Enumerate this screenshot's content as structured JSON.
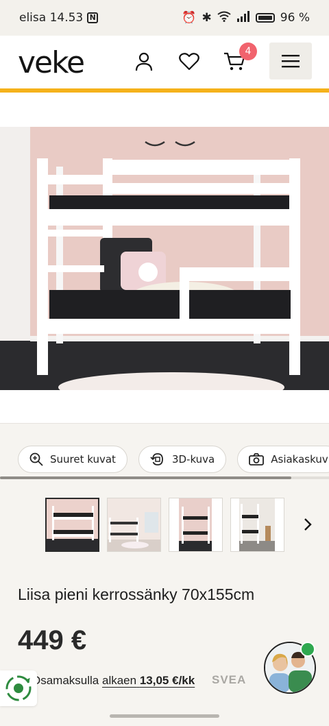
{
  "status_bar": {
    "carrier_time": "elisa 14.53",
    "nfc": "N",
    "battery": "96 %"
  },
  "header": {
    "logo": "veke",
    "cart_count": "4",
    "icons": [
      "user-icon",
      "heart-icon",
      "cart-icon",
      "menu-icon"
    ]
  },
  "colors": {
    "accent": "#f5b21b",
    "badge": "#f1636d",
    "online": "#2fa84f"
  },
  "actions": [
    {
      "label": "Suuret kuvat",
      "icon": "zoom-in-icon"
    },
    {
      "label": "3D-kuva",
      "icon": "rotate-3d-icon"
    },
    {
      "label": "Asiakaskuv",
      "icon": "camera-icon"
    }
  ],
  "product": {
    "title": "Liisa pieni kerrossänky 70x155cm",
    "price": "449 €",
    "installment_prefix": "Osamaksulla",
    "installment_link": "alkaen",
    "installment_amount": "13,05 €/kk",
    "financer": "SVEA"
  }
}
